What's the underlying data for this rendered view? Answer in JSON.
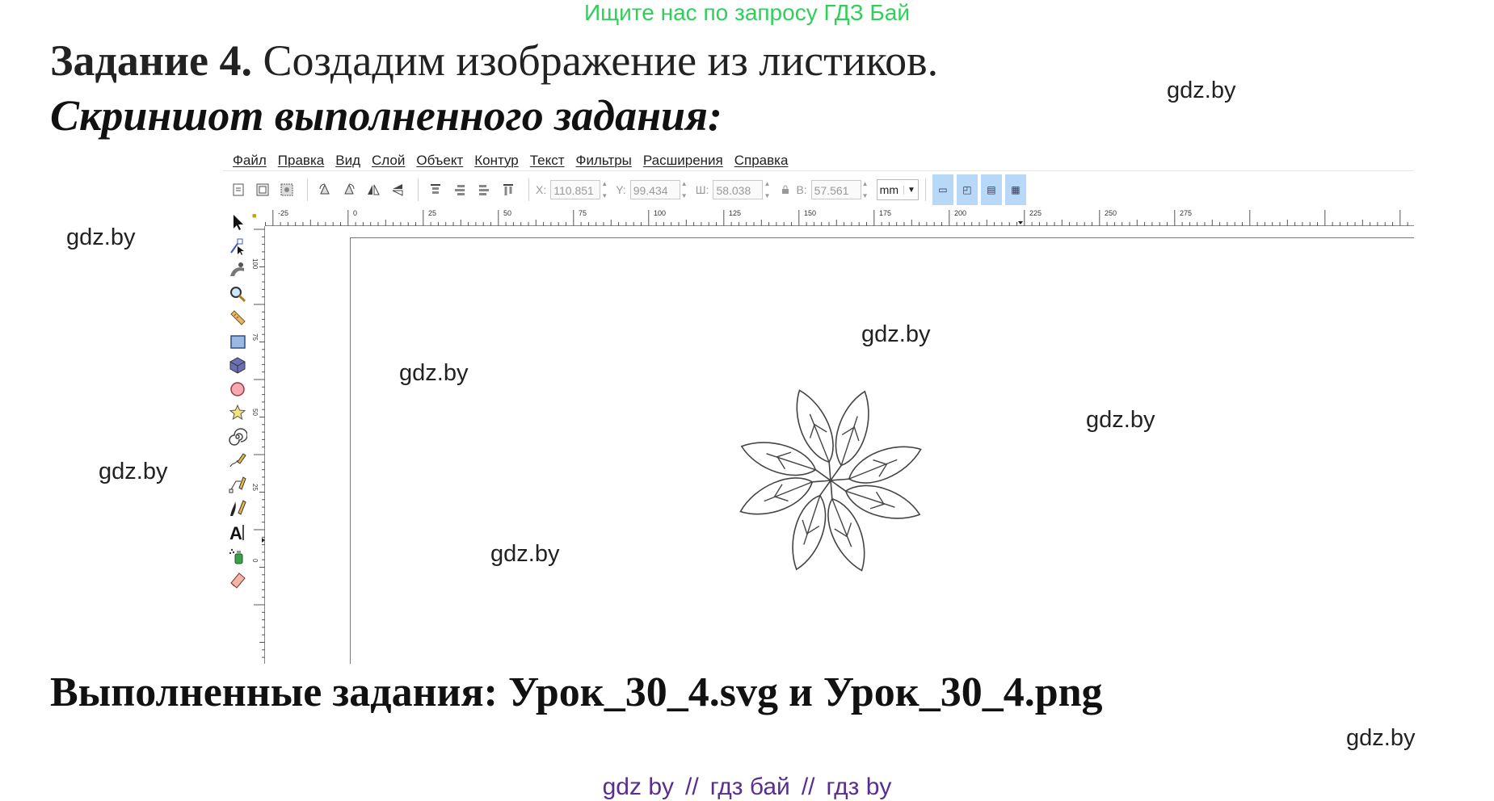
{
  "promo": "Ищите нас по запросу ГДЗ Бай",
  "heading": {
    "bold": "Задание 4.",
    "rest": "Создадим изображение из листиков."
  },
  "subtitle": "Скриншот выполненного задания:",
  "result": "Выполненные задания: Урок_30_4.svg и Урок_30_4.png",
  "watermark": "gdz.by",
  "footer": {
    "link1": "gdz by",
    "sep": "//",
    "link2": "гдз бай",
    "link3": "гдз by"
  },
  "inkscape": {
    "menu": [
      "Файл",
      "Правка",
      "Вид",
      "Слой",
      "Объект",
      "Контур",
      "Текст",
      "Фильтры",
      "Расширения",
      "Справка"
    ],
    "coords": {
      "x_label": "X:",
      "x_value": "110.851",
      "y_label": "Y:",
      "y_value": "99.434",
      "w_label": "Ш:",
      "w_value": "58.038",
      "h_label": "В:",
      "h_value": "57.561",
      "unit": "mm"
    },
    "hruler_labels": [
      "-25",
      "0",
      "25",
      "50",
      "75",
      "100",
      "125",
      "150",
      "175",
      "200",
      "225",
      "250",
      "275"
    ],
    "vruler_labels": [
      "100",
      "75",
      "50",
      "25",
      "0"
    ],
    "tools": [
      "select-tool-icon",
      "node-tool-icon",
      "tweak-tool-icon",
      "zoom-tool-icon",
      "measure-tool-icon",
      "rect-tool-icon",
      "box3d-tool-icon",
      "ellipse-tool-icon",
      "star-tool-icon",
      "spiral-tool-icon",
      "pencil-tool-icon",
      "pen-tool-icon",
      "calligraphy-tool-icon",
      "text-tool-icon",
      "spray-tool-icon",
      "eraser-tool-icon"
    ]
  }
}
